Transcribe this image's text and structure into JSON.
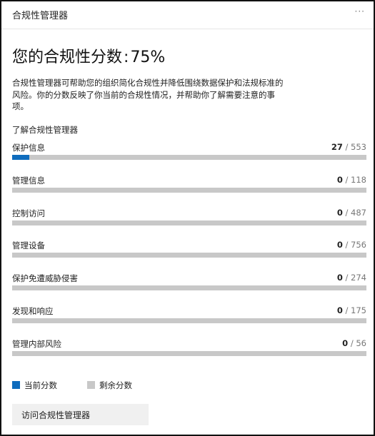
{
  "header": {
    "title": "合规性管理器",
    "more_glyph": "···"
  },
  "score": {
    "label": "您的合规性分数",
    "separator": ":",
    "value": "75%"
  },
  "description": "合规性管理器可帮助您的组织简化合规性并降低围绕数据保护和法规标准的风险。你的分数反映了你当前的合规性情况，并帮助你了解需要注意的事项。",
  "learn_link": "了解合规性管理器",
  "categories": [
    {
      "label": "保护信息",
      "current": "27",
      "sep": " / ",
      "total": "553",
      "progress": 0.0488
    },
    {
      "label": "管理信息",
      "current": "0",
      "sep": " / ",
      "total": "118",
      "progress": 0
    },
    {
      "label": "控制访问",
      "current": "0",
      "sep": " / ",
      "total": "487",
      "progress": 0
    },
    {
      "label": "管理设备",
      "current": "0",
      "sep": " / ",
      "total": "756",
      "progress": 0
    },
    {
      "label": "保护免遭威胁侵害",
      "current": "0",
      "sep": " / ",
      "total": "274",
      "progress": 0
    },
    {
      "label": "发现和响应",
      "current": "0",
      "sep": " / ",
      "total": "175",
      "progress": 0
    },
    {
      "label": "管理内部风险",
      "current": "0",
      "sep": " / ",
      "total": "56",
      "progress": 0
    }
  ],
  "legend": {
    "current": {
      "label": "当前分数",
      "color": "#0f6cbd"
    },
    "remaining": {
      "label": "剩余分数",
      "color": "#c8c8c8"
    }
  },
  "visit_button": "访问合规性管理器"
}
